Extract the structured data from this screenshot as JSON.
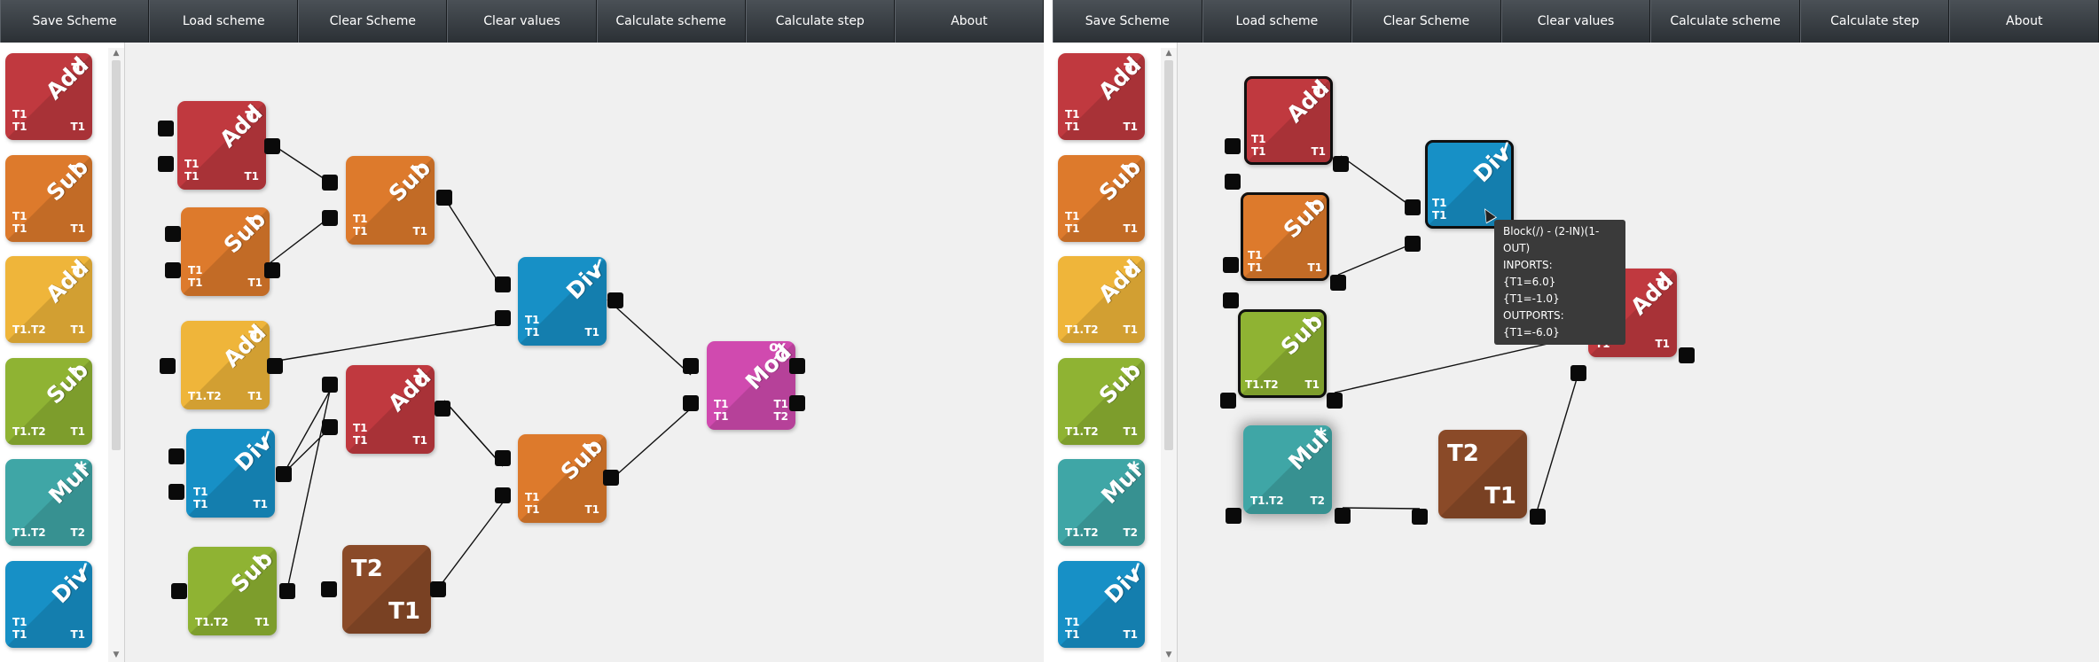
{
  "colors": {
    "add": "#c0393f",
    "sub": "#dd7a2c",
    "addy": "#efb53a",
    "subg": "#8fb333",
    "mul": "#3fa6a6",
    "div": "#1790c6",
    "mod": "#d04aaf",
    "tt": "#8a4a28"
  },
  "left": {
    "toolbar": [
      "Save Scheme",
      "Load scheme",
      "Clear Scheme",
      "Clear values",
      "Calculate scheme",
      "Calculate step",
      "About"
    ],
    "palette": [
      {
        "title": "Add",
        "sym": "+",
        "in": "T1\nT1",
        "out": "T1",
        "color": "add"
      },
      {
        "title": "Sub",
        "sym": "−",
        "in": "T1\nT1",
        "out": "T1",
        "color": "sub"
      },
      {
        "title": "Add",
        "sym": "+",
        "in": "T1.T2",
        "out": "T1",
        "color": "addy"
      },
      {
        "title": "Sub",
        "sym": "−",
        "in": "T1.T2",
        "out": "T1",
        "color": "subg"
      },
      {
        "title": "Mul",
        "sym": "*",
        "in": "T1.T2",
        "out": "T2",
        "color": "mul"
      },
      {
        "title": "Div",
        "sym": "/",
        "in": "T1\nT1",
        "out": "T1",
        "color": "div"
      }
    ],
    "blocks": [
      {
        "id": "b1",
        "title": "Add",
        "sym": "+",
        "in": "T1\nT1",
        "out": "T1",
        "color": "add"
      },
      {
        "id": "b2",
        "title": "Sub",
        "sym": "−",
        "in": "T1\nT1",
        "out": "T1",
        "color": "sub"
      },
      {
        "id": "b3",
        "title": "Sub",
        "sym": "−",
        "in": "T1\nT1",
        "out": "T1",
        "color": "sub"
      },
      {
        "id": "b4",
        "title": "Add",
        "sym": "+",
        "in": "T1.T2",
        "out": "T1",
        "color": "addy"
      },
      {
        "id": "b5",
        "title": "Div",
        "sym": "/",
        "in": "T1\nT1",
        "out": "T1",
        "color": "div"
      },
      {
        "id": "b6",
        "title": "Add",
        "sym": "+",
        "in": "T1\nT1",
        "out": "T1",
        "color": "add"
      },
      {
        "id": "b7",
        "title": "Div",
        "sym": "/",
        "in": "T1\nT1",
        "out": "T1",
        "color": "div"
      },
      {
        "id": "b8",
        "title": "Sub",
        "sym": "−",
        "in": "T1\nT1",
        "out": "T1",
        "color": "sub"
      },
      {
        "id": "b9",
        "title": "Mod",
        "sym": "%",
        "in": "T1\nT1",
        "out": "T1\nT2",
        "color": "mod"
      },
      {
        "id": "b10",
        "title": "Sub",
        "sym": "−",
        "in": "T1.T2",
        "out": "T1",
        "color": "subg"
      },
      {
        "id": "b11",
        "tt": true,
        "tl": "T2",
        "br": "T1",
        "color": "tt"
      }
    ]
  },
  "right": {
    "toolbar": [
      "Save Scheme",
      "Load scheme",
      "Clear Scheme",
      "Clear values",
      "Calculate scheme",
      "Calculate step",
      "About"
    ],
    "palette": [
      {
        "title": "Add",
        "sym": "+",
        "in": "T1\nT1",
        "out": "T1",
        "color": "add"
      },
      {
        "title": "Sub",
        "sym": "−",
        "in": "T1\nT1",
        "out": "T1",
        "color": "sub"
      },
      {
        "title": "Add",
        "sym": "+",
        "in": "T1.T2",
        "out": "T1",
        "color": "addy"
      },
      {
        "title": "Sub",
        "sym": "−",
        "in": "T1.T2",
        "out": "T1",
        "color": "subg"
      },
      {
        "title": "Mul",
        "sym": "*",
        "in": "T1.T2",
        "out": "T2",
        "color": "mul"
      },
      {
        "title": "Div",
        "sym": "/",
        "in": "T1\nT1",
        "out": "T1",
        "color": "div"
      }
    ],
    "blocks": [
      {
        "id": "r1",
        "title": "Add",
        "sym": "+",
        "in": "T1\nT1",
        "out": "T1",
        "color": "add",
        "sel": true
      },
      {
        "id": "r2",
        "title": "Sub",
        "sym": "−",
        "in": "T1\nT1",
        "out": "T1",
        "color": "sub",
        "sel": true
      },
      {
        "id": "r3",
        "title": "Sub",
        "sym": "−",
        "in": "T1.T2",
        "out": "T1",
        "color": "subg",
        "sel": true
      },
      {
        "id": "r4",
        "title": "Mul",
        "sym": "*",
        "in": "T1.T2",
        "out": "T2",
        "color": "mul"
      },
      {
        "id": "r5",
        "title": "Div",
        "sym": "/",
        "in": "T1\nT1",
        "out": "",
        "color": "div",
        "sel": true
      },
      {
        "id": "r6",
        "tt": true,
        "tl": "T2",
        "br": "T1",
        "color": "tt"
      },
      {
        "id": "r7",
        "title": "Add",
        "sym": "+",
        "in": "T1\nT1",
        "out": "T1",
        "color": "add"
      }
    ],
    "tooltip": [
      "Block(/) - (2-IN)(1-OUT)",
      "INPORTS:",
      "{T1=6.0}",
      "{T1=-1.0}",
      "OUTPORTS:",
      "{T1=-6.0}"
    ]
  }
}
